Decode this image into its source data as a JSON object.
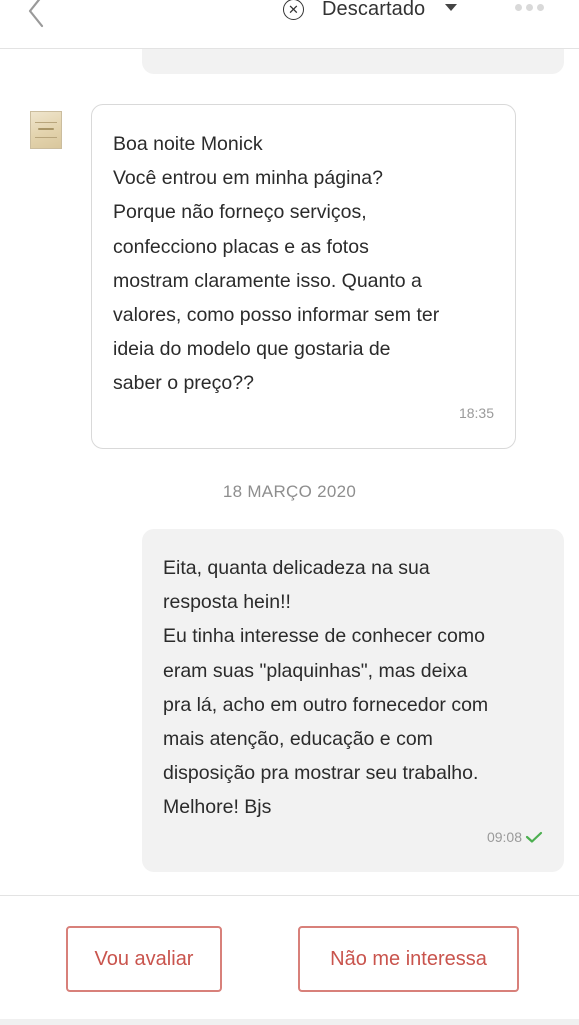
{
  "header": {
    "status_label": "Descartado",
    "back_icon": "chevron-left-icon",
    "status_icon": "close-circle-icon",
    "caret_icon": "caret-down-icon",
    "more_icon": "more-horizontal-icon"
  },
  "messages": [
    {
      "direction": "incoming",
      "text": "Boa noite Monick\nVocê entrou em minha página?\nPorque não forneço serviços,\nconfecciono placas e as fotos\nmostram claramente isso. Quanto a\nvalores, como posso informar sem ter\nideia do modelo que gostaria de\nsaber o preço??",
      "time": "18:35"
    },
    {
      "direction": "outgoing",
      "text": "Eita, quanta delicadeza na sua\nresposta hein!!\nEu tinha interesse de conhecer como\neram suas \"plaquinhas\", mas deixa\npra lá, acho em outro fornecedor com\nmais atenção, educação e com\ndisposição pra mostrar seu trabalho.\nMelhore! Bjs",
      "time": "09:08",
      "read_icon": "check-icon"
    }
  ],
  "date_separator": "18 MARÇO 2020",
  "footer": {
    "rate_button": "Vou avaliar",
    "not_interested_button": "Não me interessa"
  },
  "colors": {
    "accent": "#c9544d",
    "accent_border": "#d8807a",
    "outgoing_bubble": "#f2f2f2",
    "read_check": "#4caf50"
  }
}
